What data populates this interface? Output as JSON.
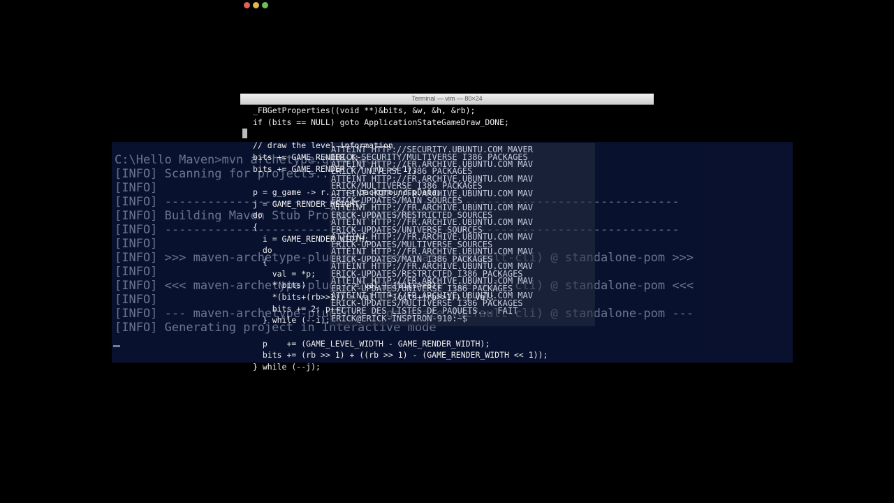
{
  "window": {
    "title": "Terminal — vim — 80×24"
  },
  "vim": {
    "lines": [
      "_FBGetProperties((void **)&bits, &w, &h, &rb);",
      "if (bits == NULL) goto ApplicationStateGameDraw_DONE;",
      "",
      "// draw the level information",
      "bits += GAME_RENDER_X;",
      "bits += GAME_RENDER_Y * (rb >> 1);",
      "",
      "p = g_game -> r... -> background.pData;",
      "j = GAME_RENDER_HEIGHT;",
      "do",
      "{",
      "  i = GAME_RENDER_WIDTH;",
      "  do",
      "  {",
      "    val = *p;",
      "    *(bits)          = val | (bits>>8);",
      "    *(bits+(rb>>1)) = val | *(bits+(rb>>1)) | val;",
      "    bits += 2; p++;",
      "  } while (--i);",
      "",
      "  p    += (GAME_LEVEL_WIDTH - GAME_RENDER_WIDTH);",
      "  bits += (rb >> 1) + ((rb >> 1) - (GAME_RENDER_WIDTH << 1));",
      "} while (--j);"
    ]
  },
  "cmd": {
    "lines": [
      "C:\\Hello Maven>mvn archetype:generate",
      "[INFO] Scanning for projects...",
      "[INFO]",
      "[INFO] ------------------------------------------------------------------------",
      "[INFO] Building Maven Stub Project (No POM) 1",
      "[INFO] ------------------------------------------------------------------------",
      "[INFO]",
      "[INFO] >>> maven-archetype-plugin:2.2:generate (default-cli) @ standalone-pom >>>",
      "[INFO]",
      "[INFO] <<< maven-archetype-plugin:2.2:generate (default-cli) @ standalone-pom <<<",
      "[INFO]",
      "[INFO] --- maven-archetype-plugin:2.2:generate (default-cli) @ standalone-pom ---",
      "[INFO] Generating project in Interactive mode"
    ]
  },
  "apt": {
    "lines": [
      "ATTEINT HTTP://SECURITY.UBUNTU.COM MAVER",
      "ERICK-SECURITY/MULTIVERSE I386 PACKAGES",
      "ATTEINT HTTP://FR.ARCHIVE.UBUNTU.COM MAV",
      "ERICK/UNIVERSE I386 PACKAGES",
      "ATTEINT HTTP://FR.ARCHIVE.UBUNTU.COM MAV",
      "ERICK/MULTIVERSE I386 PACKAGES",
      "ATTEINT HTTP://FR.ARCHIVE.UBUNTU.COM MAV",
      "ERICK-UPDATES/MAIN SOURCES",
      "ATTEINT HTTP://FR.ARCHIVE.UBUNTU.COM MAV",
      "ERICK-UPDATES/RESTRICTED SOURCES",
      "ATTEINT HTTP://FR.ARCHIVE.UBUNTU.COM MAV",
      "ERICK-UPDATES/UNIVERSE SOURCES",
      "ATTEINT HTTP://FR.ARCHIVE.UBUNTU.COM MAV",
      "ERICK-UPDATES/MULTIVERSE SOURCES",
      "ATTEINT HTTP://FR.ARCHIVE.UBUNTU.COM MAV",
      "ERICK-UPDATES/MAIN I386 PACKAGES",
      "ATTEINT HTTP://FR.ARCHIVE.UBUNTU.COM MAV",
      "ERICK-UPDATES/RESTRICTED I386 PACKAGES",
      "ATTEINT HTTP://FR.ARCHIVE.UBUNTU.COM MAV",
      "ERICK-UPDATES/UNIVERSE I386 PACKAGES",
      "ATTEINT HTTP://FR.ARCHIVE.UBUNTU.COM MAV",
      "ERICK-UPDATES/MULTIVERSE I386 PACKAGES",
      "LECTURE DES LISTES DE PAQUETS... FAIT",
      "ERICK@ERICK-INSPIRON-910:~$"
    ]
  }
}
